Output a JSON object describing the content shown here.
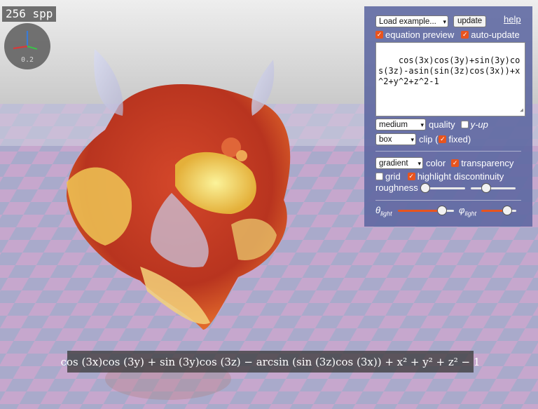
{
  "spp_counter": "256 spp",
  "gizmo": {
    "scale_label": "0.2"
  },
  "panel": {
    "load_example": "Load example...",
    "update_button": "update",
    "help_link": "help",
    "equation_preview": {
      "label": "equation preview",
      "checked": true
    },
    "auto_update": {
      "label": "auto-update",
      "checked": true
    },
    "equation_text": "cos(3x)cos(3y)+sin(3y)cos(3z)-asin(sin(3z)cos(3x))+x^2+y^2+z^2-1",
    "quality": {
      "value": "medium",
      "label": "quality"
    },
    "y_up": {
      "label": "y-up",
      "checked": false
    },
    "clip": {
      "value": "box",
      "label": "clip (",
      "fixed_label": "fixed)",
      "fixed_checked": true
    },
    "color": {
      "value": "gradient",
      "label": "color"
    },
    "transparency": {
      "label": "transparency",
      "checked": true
    },
    "grid": {
      "label": "grid",
      "checked": false
    },
    "highlight_discontinuity": {
      "label": "highlight discontinuity",
      "checked": true
    },
    "roughness": {
      "label": "roughness",
      "values": [
        0.0,
        0.3
      ]
    },
    "theta_light": {
      "symbol": "θ",
      "sub": "light",
      "value": 0.8
    },
    "phi_light": {
      "symbol": "φ",
      "sub": "light",
      "value": 0.75
    },
    "accent_color": "#e8541e"
  },
  "formula_preview": "cos (3x)cos (3y) + sin (3y)cos (3z) − arcsin (sin (3z)cos (3x)) + x² + y² + z² − 1"
}
